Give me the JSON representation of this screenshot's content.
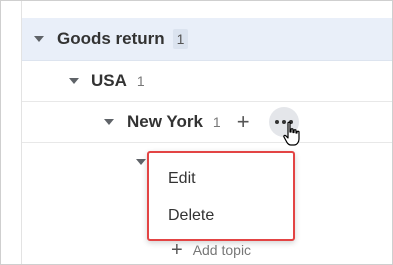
{
  "tree": {
    "goods": {
      "label": "Goods return",
      "count": "1"
    },
    "usa": {
      "label": "USA",
      "count": "1"
    },
    "new_york": {
      "label": "New York",
      "count": "1",
      "add_icon": "plus-icon",
      "more_icon": "more-horizontal-icon"
    }
  },
  "context_menu": {
    "items": [
      {
        "label": "Edit"
      },
      {
        "label": "Delete"
      }
    ],
    "highlight_color": "#e34444"
  },
  "add_topic": {
    "label": "Add topic",
    "icon": "plus-icon"
  },
  "colors": {
    "selected_row_bg": "#e9eff9",
    "text": "#333333",
    "muted": "#777777"
  }
}
